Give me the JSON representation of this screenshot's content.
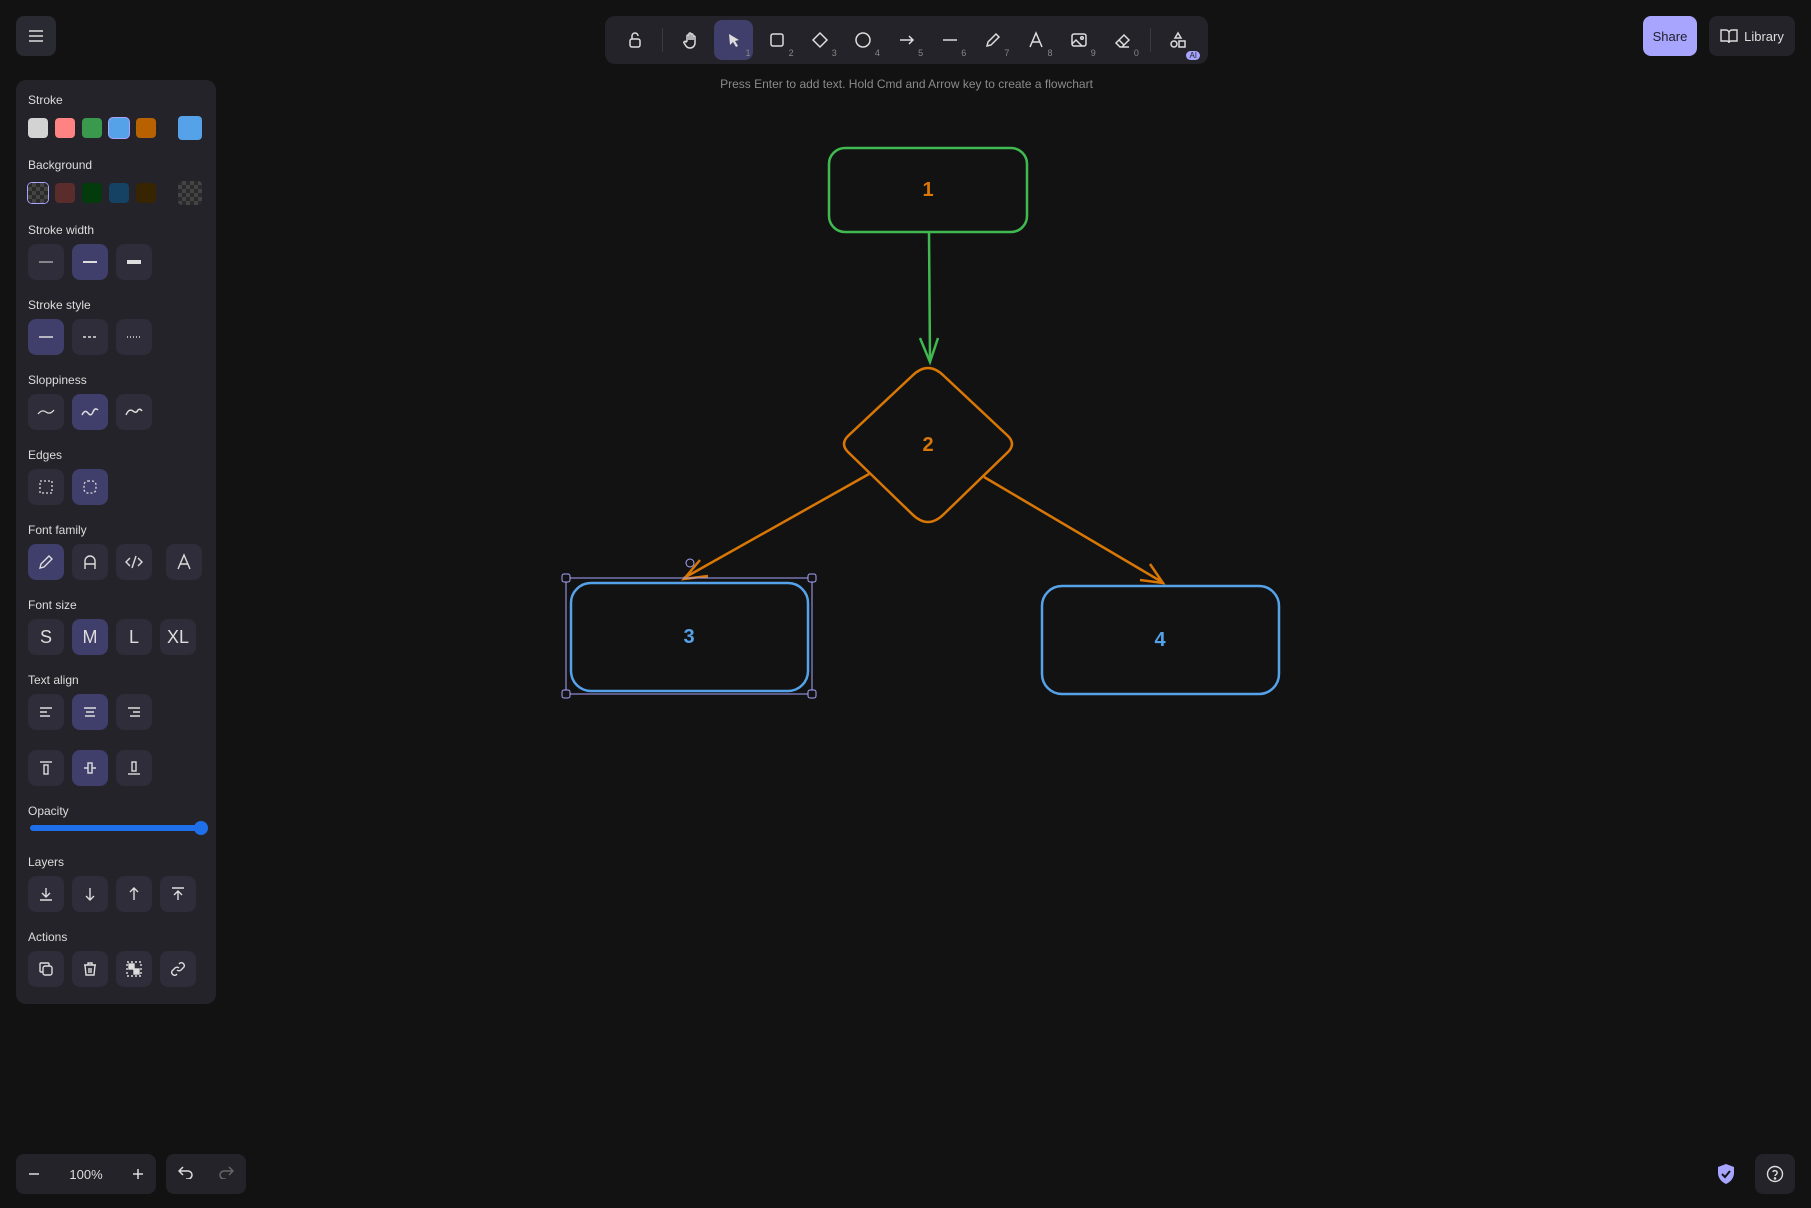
{
  "toolbar": {
    "tools": [
      {
        "name": "lock",
        "key": ""
      },
      {
        "name": "hand",
        "key": ""
      },
      {
        "name": "selection",
        "key": "1"
      },
      {
        "name": "rectangle",
        "key": "2"
      },
      {
        "name": "diamond",
        "key": "3"
      },
      {
        "name": "ellipse",
        "key": "4"
      },
      {
        "name": "arrow",
        "key": "5"
      },
      {
        "name": "line",
        "key": "6"
      },
      {
        "name": "draw",
        "key": "7"
      },
      {
        "name": "text",
        "key": "8"
      },
      {
        "name": "image",
        "key": "9"
      },
      {
        "name": "eraser",
        "key": "0"
      },
      {
        "name": "more-tools",
        "key": ""
      }
    ],
    "ai_badge": "AI",
    "hint": "Press Enter to add text. Hold Cmd and Arrow key to create a flowchart"
  },
  "header": {
    "share_label": "Share",
    "library_label": "Library"
  },
  "panel": {
    "stroke_label": "Stroke",
    "stroke_colors": [
      "#d3d3d3",
      "#ff8383",
      "#3a994c",
      "#56a2e8",
      "#b76100"
    ],
    "stroke_selected": "#56a2e8",
    "background_label": "Background",
    "background_colors": [
      "transparent",
      "#5b2c2c",
      "#043b0c",
      "#154163",
      "#362500"
    ],
    "stroke_width_label": "Stroke width",
    "stroke_style_label": "Stroke style",
    "sloppiness_label": "Sloppiness",
    "edges_label": "Edges",
    "font_family_label": "Font family",
    "font_size_label": "Font size",
    "font_sizes": [
      "S",
      "M",
      "L",
      "XL"
    ],
    "text_align_label": "Text align",
    "opacity_label": "Opacity",
    "opacity_value": 100,
    "layers_label": "Layers",
    "actions_label": "Actions"
  },
  "footer": {
    "zoom": "100%"
  },
  "diagram": {
    "nodes": [
      {
        "id": "1",
        "label": "1",
        "shape": "rectangle",
        "color": "#3fb950"
      },
      {
        "id": "2",
        "label": "2",
        "shape": "diamond",
        "color": "#d97706"
      },
      {
        "id": "3",
        "label": "3",
        "shape": "rectangle",
        "color": "#56a2e8",
        "selected": true
      },
      {
        "id": "4",
        "label": "4",
        "shape": "rectangle",
        "color": "#56a2e8"
      }
    ],
    "edges": [
      {
        "from": "1",
        "to": "2",
        "color": "#3fb950"
      },
      {
        "from": "2",
        "to": "3",
        "color": "#d97706"
      },
      {
        "from": "2",
        "to": "4",
        "color": "#d97706"
      }
    ]
  }
}
